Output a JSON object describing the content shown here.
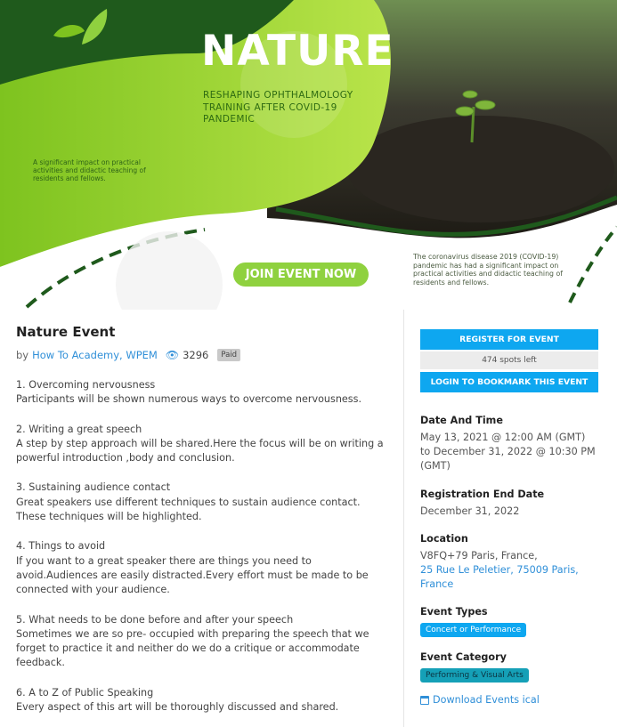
{
  "banner": {
    "title": "NATURE",
    "subtitle": "RESHAPING OPHTHALMOLOGY TRAINING AFTER COVID-19 PANDEMIC",
    "left_note": "A significant impact on practical activities and didactic teaching of residents and fellows.",
    "right_note": "The coronavirus disease 2019 (COVID-19) pandemic has had a significant impact on practical activities and didactic teaching of residents and fellows.",
    "cta_label": "JOIN EVENT NOW"
  },
  "event": {
    "title": "Nature Event",
    "by_label": "by",
    "host": "How To Academy, WPEM",
    "views": "3296",
    "price_badge": "Paid"
  },
  "description": [
    {
      "heading": "1. Overcoming nervousness",
      "body": "Participants will be shown numerous ways to overcome nervousness."
    },
    {
      "heading": "2. Writing a great speech",
      "body": "A step by step approach will be shared.Here the focus will be on writing a powerful introduction ,body and conclusion."
    },
    {
      "heading": "3. Sustaining audience contact",
      "body": "Great speakers use different techniques to sustain audience contact. These techniques will be highlighted."
    },
    {
      "heading": "4. Things to avoid",
      "body": "If you want to a great speaker there are things you need to avoid.Audiences are easily distracted.Every effort must be made to be connected with your audience."
    },
    {
      "heading": "5. What needs to be done before and after your speech",
      "body": "Sometimes we are so pre- occupied with preparing the speech that we forget to practice it and neither do we do a critique or accommodate feedback."
    },
    {
      "heading": "6. A to Z of Public Speaking",
      "body": "Every aspect of this art will be thoroughly discussed and shared."
    }
  ],
  "sidebar": {
    "register_label": "REGISTER FOR EVENT",
    "spots_left": "474 spots left",
    "bookmark_label": "LOGIN TO BOOKMARK THIS EVENT",
    "date_time_heading": "Date And Time",
    "date_time_value": "May 13, 2021 @ 12:00 AM (GMT) to December 31, 2022 @ 10:30 PM (GMT)",
    "reg_end_heading": "Registration End Date",
    "reg_end_value": "December 31, 2022",
    "location_heading": "Location",
    "location_line1": "V8FQ+79 Paris, France,",
    "location_link": "25 Rue Le Peletier, 75009 Paris, France",
    "event_types_heading": "Event Types",
    "event_type_tag": "Concert or Performance",
    "event_category_heading": "Event Category",
    "event_category_tag": "Performing & Visual Arts",
    "ical_label": "Download Events ical"
  },
  "colors": {
    "accent_blue": "#0ea7f0",
    "link_blue": "#2f8fd8",
    "banner_green": "#8fd13f",
    "dark_green": "#1f5a1c"
  }
}
